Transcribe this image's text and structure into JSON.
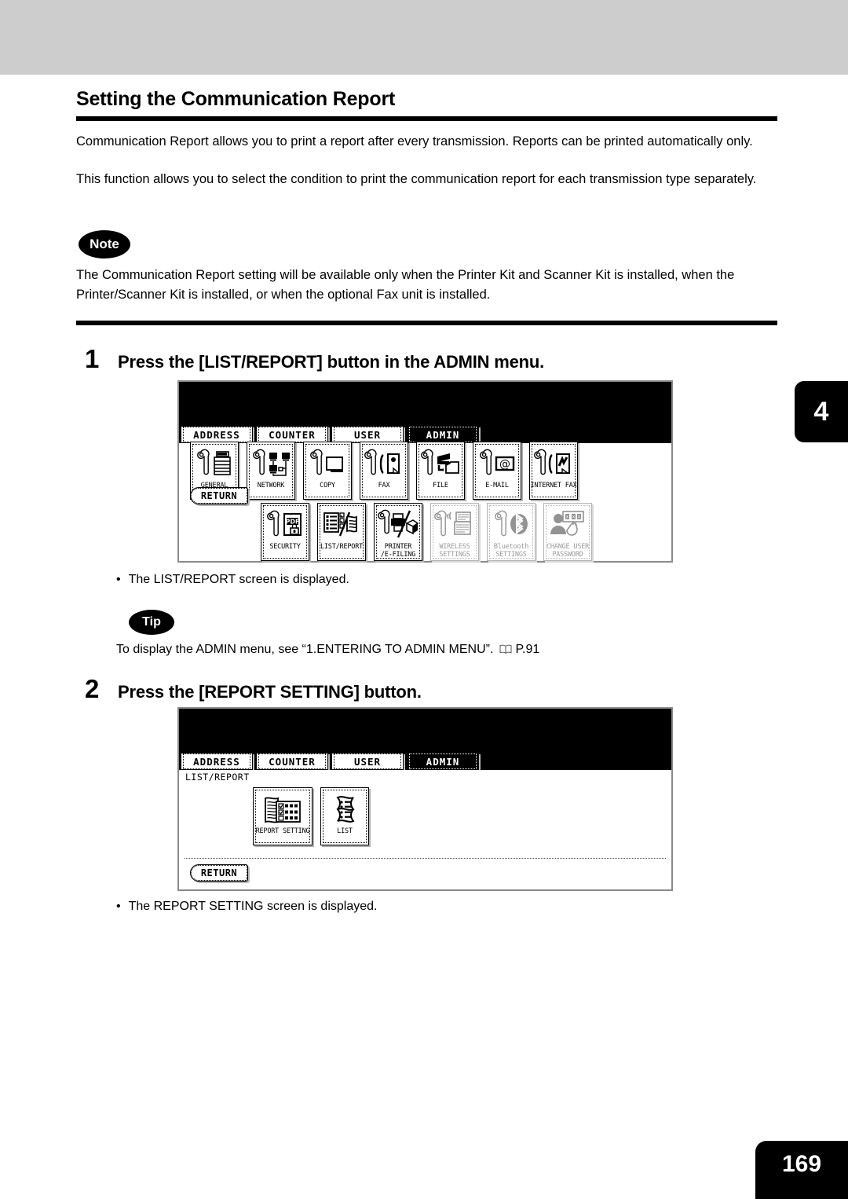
{
  "page": {
    "number": "169",
    "chapter_tab": "4"
  },
  "heading": "Setting the Communication Report",
  "intro": {
    "p1": "Communication Report allows you to print a report after every transmission.  Reports can be printed automatically only.",
    "p2": "This function allows you to select the condition to print the communication report for each transmission type separately."
  },
  "note": {
    "label": "Note",
    "text": "The Communication Report setting will be available only when the Printer Kit and Scanner Kit is installed, when the Printer/Scanner Kit is installed, or when the optional Fax unit is installed."
  },
  "steps": [
    {
      "number": "1",
      "title": "Press the [LIST/REPORT] button in the ADMIN menu.",
      "result": "The LIST/REPORT screen is displayed.",
      "bullet_char": "•"
    },
    {
      "number": "2",
      "title": "Press the [REPORT SETTING] button.",
      "result": "The REPORT SETTING screen is displayed.",
      "bullet_char": "•"
    }
  ],
  "tip": {
    "label": "Tip",
    "text_before": "To display the ADMIN menu, see “1.ENTERING TO ADMIN MENU”.",
    "page_ref": "P.91"
  },
  "screen_admin": {
    "tabs": [
      {
        "label": "ADDRESS",
        "active": false
      },
      {
        "label": "COUNTER",
        "active": false
      },
      {
        "label": "USER",
        "active": false
      },
      {
        "label": "ADMIN",
        "active": true
      }
    ],
    "return_label": "RETURN",
    "row1": [
      {
        "label": "GENERAL",
        "icon": "wrench-copier-icon",
        "disabled": false
      },
      {
        "label": "NETWORK",
        "icon": "wrench-network-icon",
        "disabled": false
      },
      {
        "label": "COPY",
        "icon": "wrench-copy-icon",
        "disabled": false
      },
      {
        "label": "FAX",
        "icon": "wrench-fax-icon",
        "disabled": false
      },
      {
        "label": "FILE",
        "icon": "wrench-file-icon",
        "disabled": false
      },
      {
        "label": "E-MAIL",
        "icon": "wrench-email-icon",
        "disabled": false
      },
      {
        "label": "INTERNET FAX",
        "icon": "wrench-internetfax-icon",
        "disabled": false
      }
    ],
    "row2": [
      {
        "label": "SECURITY",
        "icon": "wrench-pdf-lock-icon",
        "disabled": false
      },
      {
        "label": "LIST/REPORT",
        "icon": "list-report-icon",
        "disabled": false
      },
      {
        "label": "PRINTER\n/E-FILING",
        "icon": "wrench-printer-efiling-icon",
        "disabled": false
      },
      {
        "label": "WIRELESS\nSETTINGS",
        "icon": "wrench-wireless-icon",
        "disabled": true
      },
      {
        "label": "Bluetooth\nSETTINGS",
        "icon": "wrench-bluetooth-icon",
        "disabled": true
      },
      {
        "label": "CHANGE USER\nPASSWORD",
        "icon": "change-user-password-icon",
        "disabled": true
      }
    ]
  },
  "screen_listreport": {
    "tabs": [
      {
        "label": "ADDRESS",
        "active": false
      },
      {
        "label": "COUNTER",
        "active": false
      },
      {
        "label": "USER",
        "active": false
      },
      {
        "label": "ADMIN",
        "active": true
      }
    ],
    "breadcrumb": "LIST/REPORT",
    "return_label": "RETURN",
    "buttons": [
      {
        "label": "REPORT SETTING",
        "icon": "report-setting-icon"
      },
      {
        "label": "LIST",
        "icon": "list-icon"
      }
    ]
  }
}
